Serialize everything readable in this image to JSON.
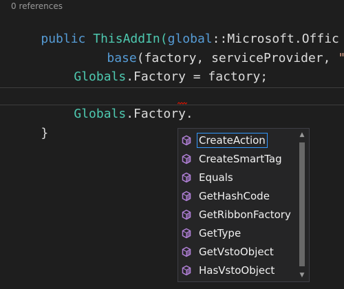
{
  "codelens": "0 references",
  "code": {
    "line1": {
      "kw1": "public",
      "name": " ThisAddIn(",
      "kw2": "global",
      "rest": "::",
      "ns": "Microsoft.Offic"
    },
    "line2": {
      "kw": "base",
      "rest": "(factory, serviceProvider, ",
      "str": "\""
    },
    "line3": {
      "type": "Globals",
      "rest": ".Factory = factory;"
    },
    "line4": {
      "type": "Globals",
      "rest": ".Factory."
    },
    "line5": {
      "brace": "}"
    }
  },
  "completion": {
    "items": [
      {
        "label": "CreateAction",
        "icon": "method-icon",
        "selected": true
      },
      {
        "label": "CreateSmartTag",
        "icon": "method-icon"
      },
      {
        "label": "Equals",
        "icon": "method-icon"
      },
      {
        "label": "GetHashCode",
        "icon": "method-icon"
      },
      {
        "label": "GetRibbonFactory",
        "icon": "method-icon"
      },
      {
        "label": "GetType",
        "icon": "method-icon"
      },
      {
        "label": "GetVstoObject",
        "icon": "method-icon"
      },
      {
        "label": "HasVstoObject",
        "icon": "method-icon"
      }
    ],
    "scroll_up_glyph": "▲",
    "scroll_down_glyph": "▼"
  },
  "colors": {
    "background": "#1e1e1e",
    "keyword": "#569cd6",
    "type": "#4ec9b0",
    "method_icon": "#b180d7",
    "selection_border": "#3399ff"
  }
}
